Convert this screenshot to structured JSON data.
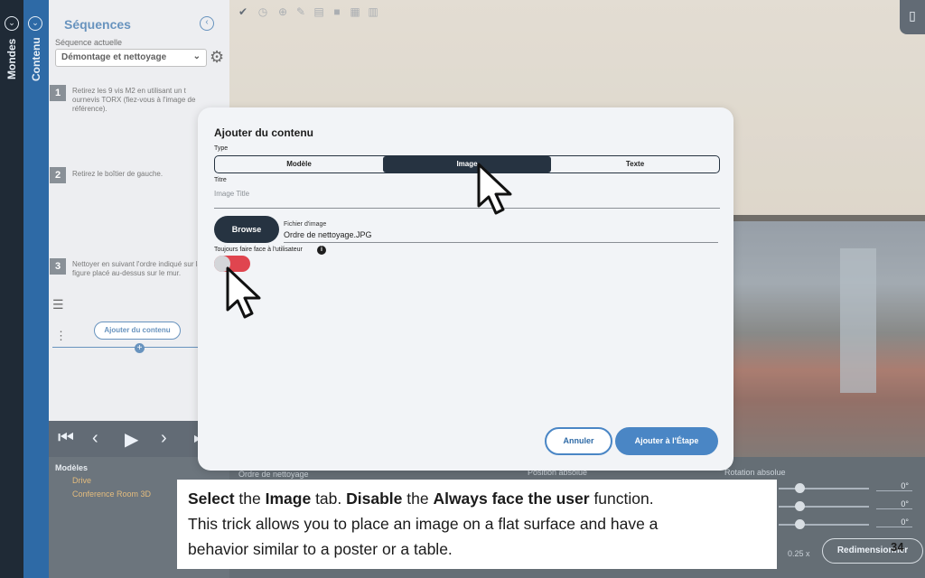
{
  "rails": {
    "mondes": "Mondes",
    "contenu": "Contenu"
  },
  "panel": {
    "title": "Séquences",
    "current_label": "Séquence actuelle",
    "current_value": "Démontage et nettoyage",
    "steps": [
      {
        "num": "1",
        "text": "Retirez les 9 vis M2 en utilisant un t ournevis TORX (fiez-vous à l'image de référence)."
      },
      {
        "num": "2",
        "text": "Retirez le boîtier de gauche."
      },
      {
        "num": "3",
        "text": "Nettoyer en suivant l'ordre indiqué sur la figure placé au-dessus sur le mur."
      }
    ],
    "add_button": "Ajouter du contenu"
  },
  "bottom": {
    "models_title": "Modèles",
    "models": [
      "Drive",
      "Conference Room 3D"
    ],
    "object_name": "Ordre de nettoyage",
    "position_label": "Position absolue",
    "rotation_label": "Rotation absolue",
    "rotations": [
      "0°",
      "0°",
      "0°"
    ],
    "scale": "0.25 x",
    "resize_button": "Redimensionner"
  },
  "modal": {
    "title": "Ajouter du contenu",
    "type_label": "Type",
    "tabs": [
      "Modèle",
      "Image",
      "Texte"
    ],
    "active_tab": "Image",
    "title_label": "Titre",
    "title_placeholder": "Image Title",
    "browse": "Browse",
    "file_label": "Fichier d'image",
    "file_value": "Ordre de nettoyage.JPG",
    "toggle_label": "Toujours faire face à l'utilisateur",
    "cancel": "Annuler",
    "submit": "Ajouter à l'Étape"
  },
  "caption": {
    "line1_parts": [
      "Select",
      " the ",
      "Image",
      " tab. ",
      "Disable",
      " the ",
      "Always face the user",
      " function."
    ],
    "line2": "This trick allows you to place an image on a flat surface and have a",
    "line3": "behavior similar to a poster or a table."
  },
  "page_number": "34",
  "colors": {
    "accent": "#2e6aa6",
    "dark": "#263341",
    "toggle": "#e0454f"
  }
}
